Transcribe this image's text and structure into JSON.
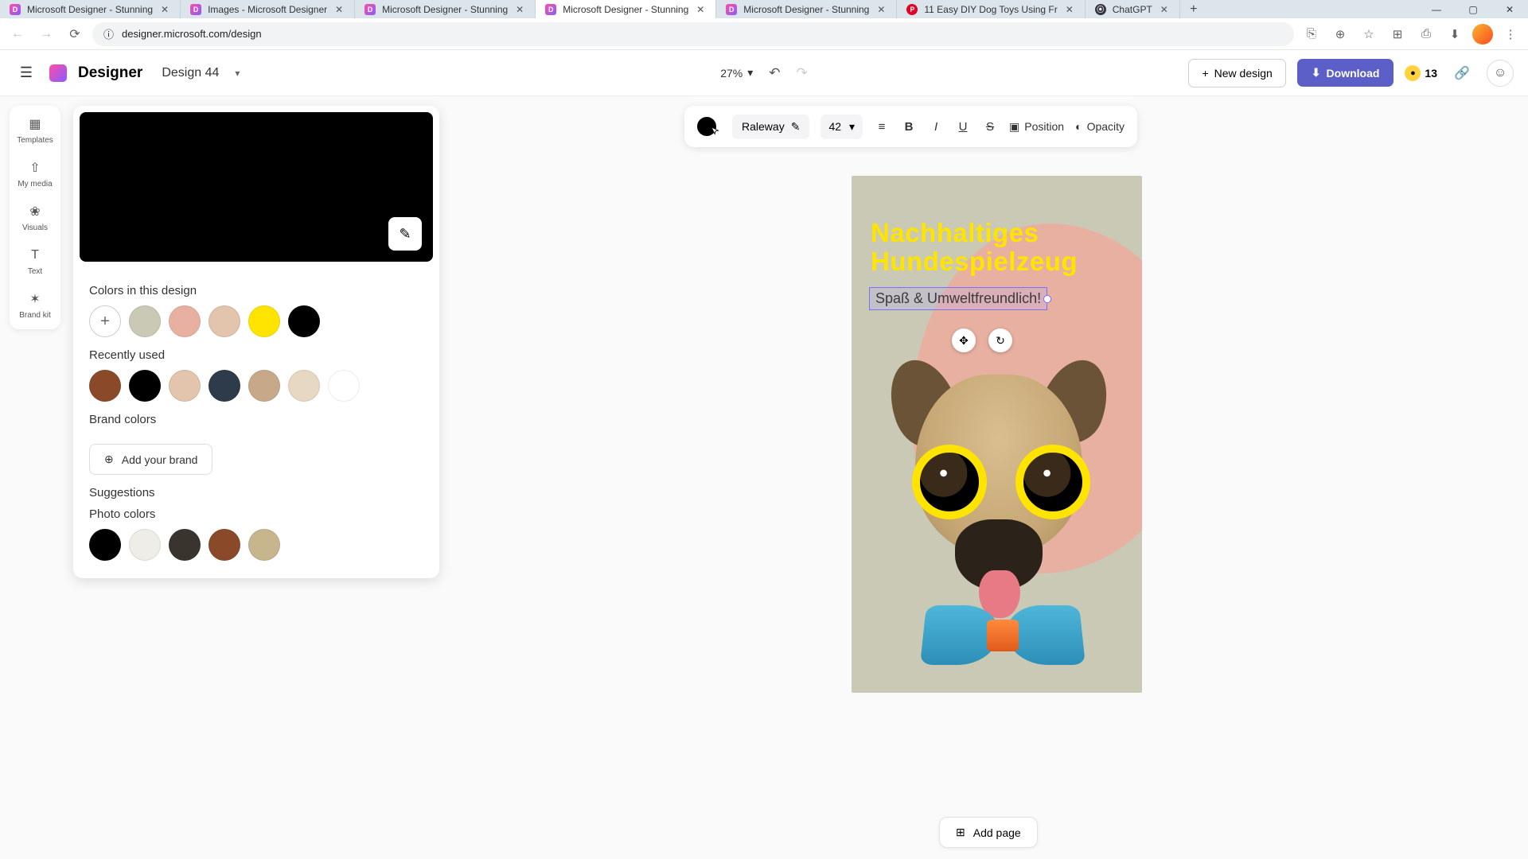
{
  "browser": {
    "tabs": [
      {
        "title": "Microsoft Designer - Stunning",
        "fav": "d"
      },
      {
        "title": "Images - Microsoft Designer",
        "fav": "d"
      },
      {
        "title": "Microsoft Designer - Stunning",
        "fav": "d"
      },
      {
        "title": "Microsoft Designer - Stunning",
        "fav": "d",
        "active": true
      },
      {
        "title": "Microsoft Designer - Stunning",
        "fav": "d"
      },
      {
        "title": "11 Easy DIY Dog Toys Using Fr",
        "fav": "p"
      },
      {
        "title": "ChatGPT",
        "fav": "c"
      }
    ],
    "url": "designer.microsoft.com/design"
  },
  "app": {
    "brand": "Designer",
    "doc_name": "Design 44",
    "zoom": "27%",
    "new_design": "New design",
    "download": "Download",
    "credits": "13"
  },
  "rail": {
    "items": [
      {
        "icon": "▦",
        "label": "Templates"
      },
      {
        "icon": "⇧",
        "label": "My media"
      },
      {
        "icon": "❀",
        "label": "Visuals"
      },
      {
        "icon": "T",
        "label": "Text"
      },
      {
        "icon": "✶",
        "label": "Brand kit"
      }
    ]
  },
  "color_panel": {
    "sect1": "Colors in this design",
    "design_colors": [
      "#c9c9b5",
      "#e8b0a0",
      "#e3c4ad",
      "#ffe400",
      "#000000"
    ],
    "sect2": "Recently used",
    "recent_colors": [
      "#8a4a2a",
      "#000000",
      "#e3c4ad",
      "#2e3b4a",
      "#c7a98a",
      "#e6d8c2",
      "#ffffff"
    ],
    "sect3": "Brand colors",
    "add_brand": "Add your brand",
    "sect4": "Suggestions",
    "sect5": "Photo colors",
    "photo_colors": [
      "#000000",
      "#efede8",
      "#3a342e",
      "#8a4a2a",
      "#c7b58e"
    ]
  },
  "text_toolbar": {
    "font": "Raleway",
    "size": "42",
    "position": "Position",
    "opacity": "Opacity"
  },
  "canvas": {
    "headline_l1": "Nachhaltiges",
    "headline_l2": "Hundespielzeug",
    "subtitle": "Spaß & Umweltfreundlich!"
  },
  "footer": {
    "add_page": "Add page"
  }
}
